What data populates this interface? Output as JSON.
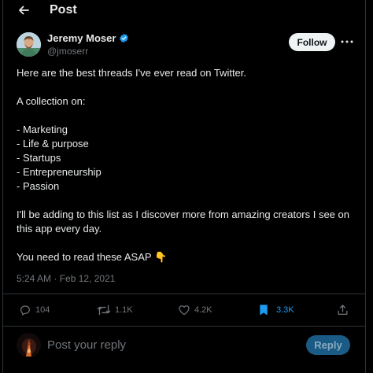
{
  "header": {
    "title": "Post",
    "back_icon": "arrow-left-icon"
  },
  "author": {
    "name": "Jeremy Moser",
    "handle": "@jmoserr",
    "verified": true,
    "verified_color": "#1d9bf0"
  },
  "follow_label": "Follow",
  "tweet": {
    "lines": [
      "Here are the best threads I've ever read on Twitter.",
      "",
      "A collection on:",
      "",
      "- Marketing",
      "- Life & purpose",
      "- Startups",
      "- Entrepreneurship",
      "- Passion",
      "",
      "I'll be adding to this list as I discover more from amazing creators I see on",
      "this app every day.",
      "",
      "You need to read these ASAP"
    ],
    "emoji": "👇",
    "timestamp": "5:24 AM · Feb 12, 2021"
  },
  "actions": {
    "replies": "104",
    "retweets": "1.1K",
    "likes": "4.2K",
    "bookmarks": "3.3K",
    "bookmarked": true,
    "accent": "#1d9bf0"
  },
  "composer": {
    "placeholder": "Post your reply",
    "reply_label": "Reply"
  }
}
